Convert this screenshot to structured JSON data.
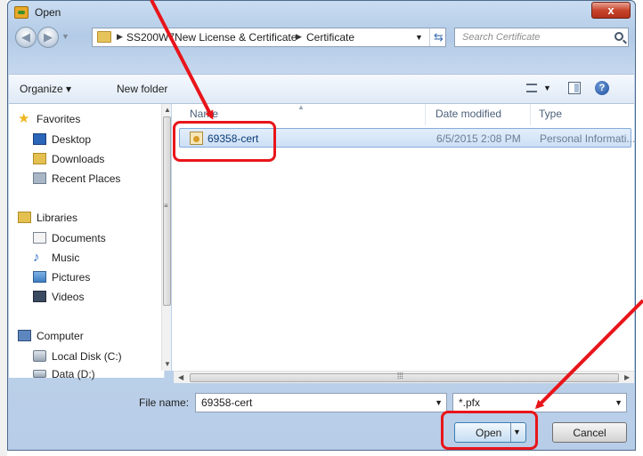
{
  "window": {
    "title": "Open",
    "close_label": "x"
  },
  "nav": {
    "back_icon": "back-arrow-icon",
    "forward_icon": "forward-arrow-icon",
    "breadcrumb": [
      "SS200W7New License & Certificate",
      "Certificate"
    ],
    "search_placeholder": "Search Certificate"
  },
  "toolbar": {
    "organize_label": "Organize ▾",
    "new_folder_label": "New folder",
    "help_label": "?"
  },
  "sidebar": {
    "favorites": {
      "label": "Favorites",
      "items": [
        "Desktop",
        "Downloads",
        "Recent Places"
      ]
    },
    "libraries": {
      "label": "Libraries",
      "items": [
        "Documents",
        "Music",
        "Pictures",
        "Videos"
      ]
    },
    "computer": {
      "label": "Computer",
      "items": [
        "Local Disk (C:)",
        "Data (D:)"
      ]
    }
  },
  "columns": [
    "Name",
    "Date modified",
    "Type"
  ],
  "files": [
    {
      "name": "69358-cert",
      "date_modified": "6/5/2015 2:08 PM",
      "type": "Personal Informati..."
    }
  ],
  "bottom": {
    "file_name_label": "File name:",
    "file_name_value": "69358-cert",
    "filter_value": "*.pfx",
    "open_label": "Open",
    "cancel_label": "Cancel"
  },
  "annotation_color": "#e8151b"
}
